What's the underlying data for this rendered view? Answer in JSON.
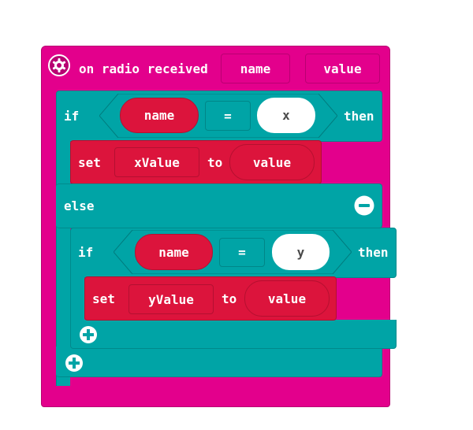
{
  "colors": {
    "event": "#E3008C",
    "logic": "#00A4A6",
    "variable": "#DC143C",
    "white": "#FFFFFF",
    "dark_text": "#4A4A4A"
  },
  "event_block": {
    "icon": "gear-icon",
    "label": "on radio received",
    "param_name": "name",
    "param_value": "value"
  },
  "if_block": {
    "if_label": "if",
    "condition": {
      "left": "name",
      "operator": "=",
      "right": "x"
    },
    "then_label": "then",
    "statement": {
      "set_label": "set",
      "variable": "xValue",
      "to_label": "to",
      "value": "value"
    },
    "else_label": "else",
    "remove_else_icon": "minus-circle-icon",
    "add_icon": "plus-circle-icon"
  },
  "inner_if_block": {
    "if_label": "if",
    "condition": {
      "left": "name",
      "operator": "=",
      "right": "y"
    },
    "then_label": "then",
    "statement": {
      "set_label": "set",
      "variable": "yValue",
      "to_label": "to",
      "value": "value"
    },
    "add_icon": "plus-circle-icon"
  }
}
